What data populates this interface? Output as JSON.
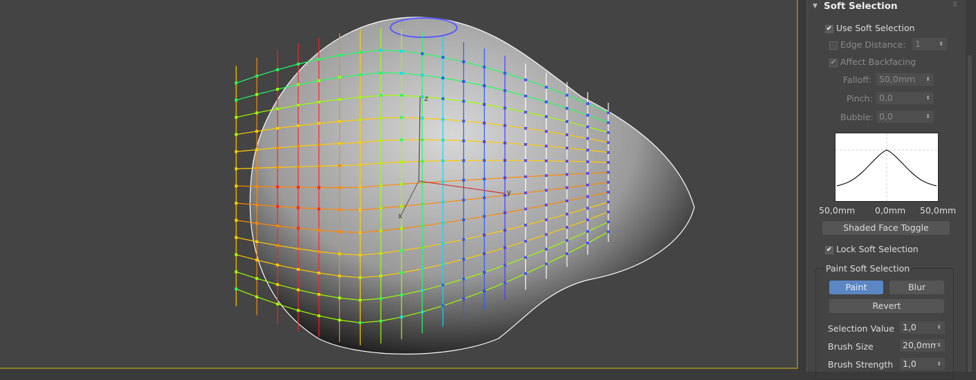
{
  "viewport": {
    "axes": {
      "x": "x",
      "y": "y",
      "z": "z"
    },
    "border_color": "#8a7a2a"
  },
  "panel": {
    "title": "Soft Selection",
    "use_soft_selection": {
      "label": "Use Soft Selection",
      "checked": true
    },
    "edge_distance": {
      "label": "Edge Distance:",
      "checked": false,
      "value": "1"
    },
    "affect_backfacing": {
      "label": "Affect Backfacing",
      "checked": true
    },
    "falloff": {
      "label": "Falloff:",
      "value": "50,0mm"
    },
    "pinch": {
      "label": "Pinch:",
      "value": "0,0"
    },
    "bubble": {
      "label": "Bubble:",
      "value": "0,0"
    },
    "curve_labels": {
      "left": "50,0mm",
      "center": "0,0mm",
      "right": "50,0mm"
    },
    "shaded_face_toggle": "Shaded Face Toggle",
    "lock_soft_selection": {
      "label": "Lock Soft Selection",
      "checked": true
    },
    "paint_group": {
      "title": "Paint Soft Selection",
      "paint": "Paint",
      "blur": "Blur",
      "revert": "Revert",
      "selection_value": {
        "label": "Selection Value",
        "value": "1,0"
      },
      "brush_size": {
        "label": "Brush Size",
        "value": "20,0mm"
      },
      "brush_strength": {
        "label": "Brush Strength",
        "value": "1,0"
      }
    },
    "accent": "#5b87c4"
  }
}
